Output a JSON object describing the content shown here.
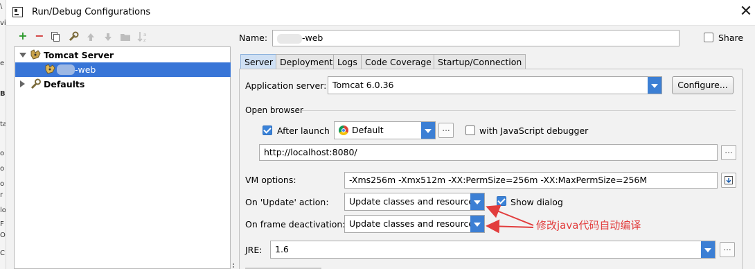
{
  "window": {
    "title": "Run/Debug Configurations",
    "close_glyph": "✕"
  },
  "background_fragments": [
    "\\",
    "vi",
    "e",
    "B",
    "ta",
    "o",
    "o",
    "o",
    "r",
    "lo",
    "F",
    "O",
    "C"
  ],
  "toolbar": {
    "add": "+",
    "remove": "−",
    "icons": [
      "add-icon",
      "remove-icon",
      "copy-icon",
      "wrench-icon",
      "move-up-icon",
      "move-down-icon",
      "folder-icon",
      "sort-icon"
    ]
  },
  "tree": {
    "group_label": "Tomcat Server",
    "item_label": "-web",
    "defaults_label": "Defaults"
  },
  "form": {
    "name_label": "Name:",
    "name_value": "-web",
    "share_label": "Share",
    "share_checked": false
  },
  "tabs": [
    {
      "label": "Server",
      "active": true
    },
    {
      "label": "Deployment",
      "active": false
    },
    {
      "label": "Logs",
      "active": false
    },
    {
      "label": "Code Coverage",
      "active": false
    },
    {
      "label": "Startup/Connection",
      "active": false
    }
  ],
  "server_tab": {
    "app_server_label": "Application server:",
    "app_server_value": "Tomcat 6.0.36",
    "configure_button": "Configure...",
    "open_browser_label": "Open browser",
    "after_launch_label": "After launch",
    "after_launch_checked": true,
    "browser_value": "Default",
    "browse_button": "...",
    "js_debugger_label": "with JavaScript debugger",
    "js_debugger_checked": false,
    "url_value": "http://localhost:8080/",
    "url_button": "...",
    "vm_options_label": "VM options:",
    "vm_options_value": "-Xms256m -Xmx512m -XX:PermSize=256m -XX:MaxPermSize=256M",
    "on_update_label": "On 'Update' action:",
    "on_update_value": "Update classes and resources",
    "show_dialog_label": "Show dialog",
    "show_dialog_checked": true,
    "on_frame_label": "On frame deactivation:",
    "on_frame_value": "Update classes and resources",
    "jre_label": "JRE:",
    "jre_value": "1.6",
    "jre_button": "..."
  },
  "annotation": {
    "text": "修改java代码自动编译",
    "color": "#e23d3d"
  },
  "colors": {
    "accent": "#3c7fd4",
    "selection": "#3875d7",
    "annotation": "#e23d3d"
  }
}
